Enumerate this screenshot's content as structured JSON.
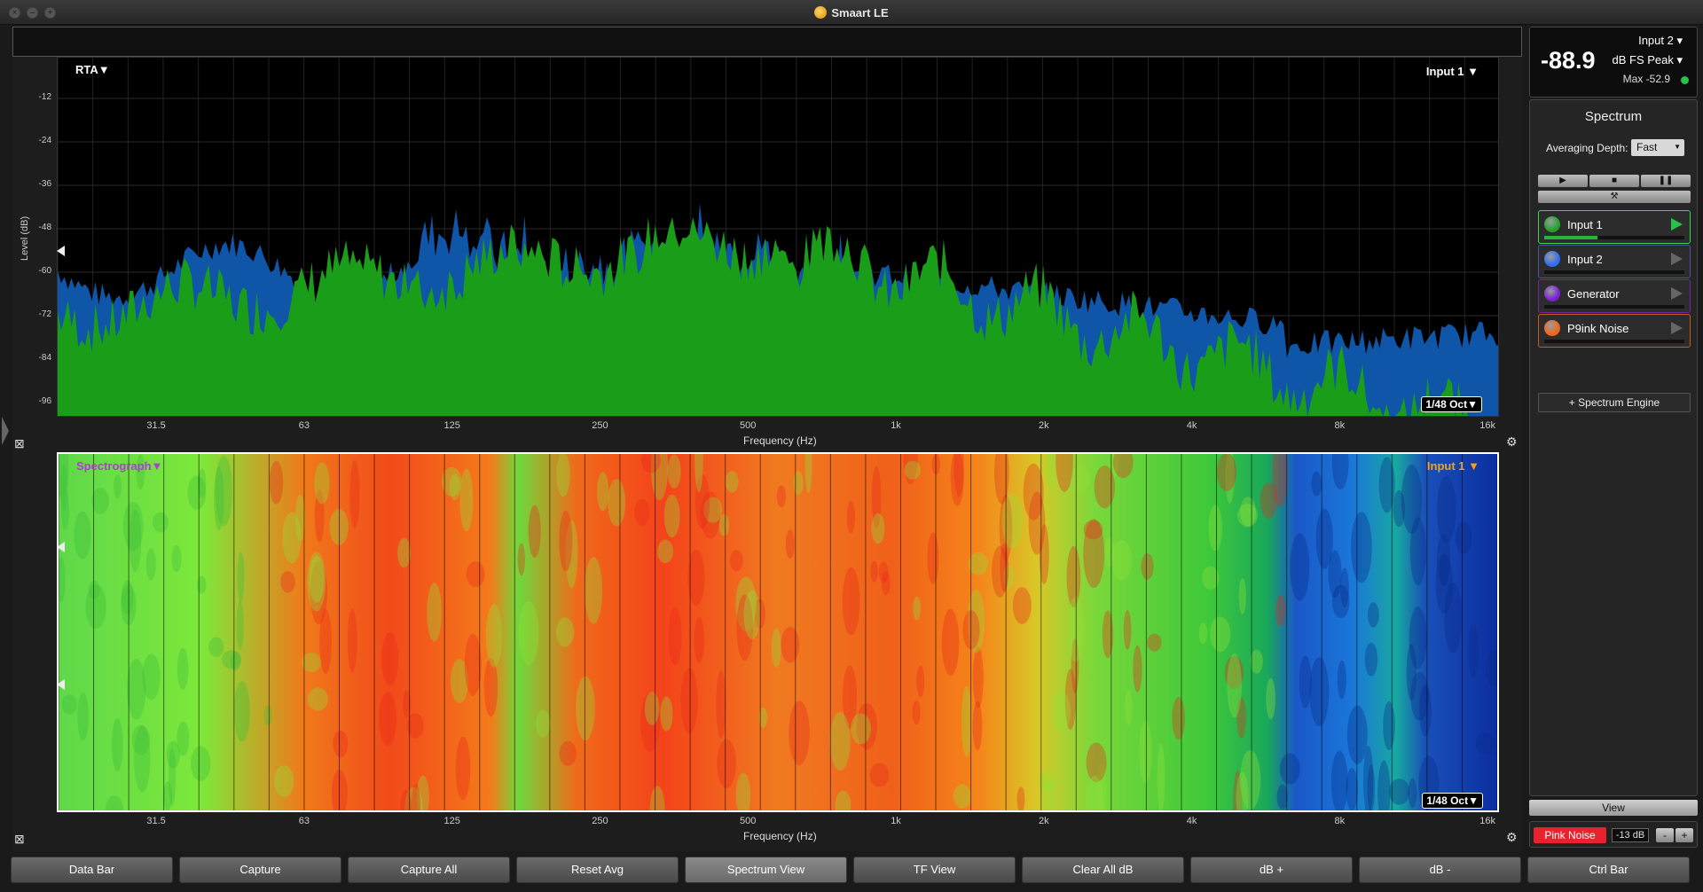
{
  "window": {
    "title": "Smaart LE"
  },
  "meter": {
    "value": "-88.9",
    "input": "Input 2",
    "mode": "dB FS Peak",
    "max": "Max -52.9"
  },
  "rta": {
    "tag": "RTA",
    "input_tag": "Input 1",
    "resolution": "1/48 Oct",
    "ylabel": "Level (dB)",
    "xlabel": "Frequency (Hz)",
    "yticks": [
      "-12",
      "-24",
      "-36",
      "-48",
      "-60",
      "-72",
      "-84",
      "-96"
    ],
    "xticks": [
      "31.5",
      "63",
      "125",
      "250",
      "500",
      "1k",
      "2k",
      "4k",
      "8k",
      "16k"
    ],
    "colors": {
      "input1": "#1a9e1a",
      "input2": "#0f56a8"
    }
  },
  "spectrograph": {
    "tag": "Spectrograph",
    "input_tag": "Input 1",
    "resolution": "1/48 Oct",
    "xlabel": "Frequency (Hz)",
    "xticks": [
      "31.5",
      "63",
      "125",
      "250",
      "500",
      "1k",
      "2k",
      "4k",
      "8k",
      "16k"
    ]
  },
  "control": {
    "header": "Spectrum",
    "averaging_label": "Averaging Depth:",
    "averaging_value": "Fast",
    "sources": [
      {
        "label": "Input 1",
        "color": "#1fa32b",
        "border": "#3bd64a"
      },
      {
        "label": "Input 2",
        "color": "#2f6df5",
        "border": "#4a4fa8"
      },
      {
        "label": "Generator",
        "color": "#7b1fd6",
        "border": "#6a2aa0"
      },
      {
        "label": "P9ink Noise",
        "color": "#f2641a",
        "border": "#c75a1a"
      }
    ],
    "add_engine": "+ Spectrum Engine"
  },
  "view_label": "View",
  "generator": {
    "button": "Pink Noise",
    "level": "-13 dB",
    "minus": "-",
    "plus": "+"
  },
  "bottom_bar": [
    "Data Bar",
    "Capture",
    "Capture All",
    "Reset Avg",
    "Spectrum View",
    "TF View",
    "Clear All dB",
    "dB +",
    "dB -",
    "Ctrl Bar"
  ]
}
